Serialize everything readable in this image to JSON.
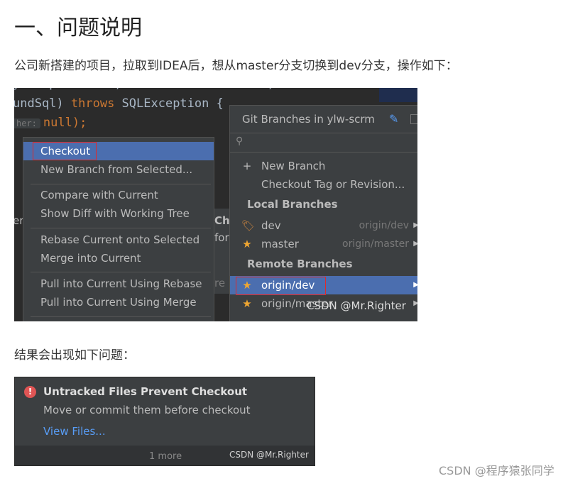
{
  "heading": "一、问题说明",
  "intro": "公司新搭建的项目，拉取到IDEA后，想从master分支切换到dev分支，操作如下：",
  "result_text": "结果会出现如下问题：",
  "page_watermark": "CSDN @程序猿张同学",
  "screenshot1": {
    "code_lines": [
      "undSql) throws SQLException {",
      "null);"
    ],
    "code_kw": "throws",
    "code_hint": "her:",
    "context_menu": [
      "Checkout",
      "New Branch from Selected...",
      "Compare with Current",
      "Show Diff with Working Tree",
      "Rebase Current onto Selected",
      "Merge into Current",
      "Pull into Current Using Rebase",
      "Pull into Current Using Merge"
    ],
    "middle_fragments": [
      "Ch",
      "for",
      "re"
    ],
    "left_fragment": "er",
    "git_popup": {
      "title": "Git Branches in ylw-scrm",
      "search_icon": "search-icon",
      "actions": [
        "New Branch",
        "Checkout Tag or Revision..."
      ],
      "local_header": "Local Branches",
      "local": [
        {
          "name": "dev",
          "tracking": "origin/dev",
          "icon": "tag-icon"
        },
        {
          "name": "master",
          "tracking": "origin/master",
          "icon": "star-icon"
        }
      ],
      "remote_header": "Remote Branches",
      "remote": [
        {
          "name": "origin/dev",
          "icon": "star-icon"
        },
        {
          "name": "origin/master",
          "icon": "star-icon"
        }
      ]
    },
    "watermark": "CSDN @Mr.Righter"
  },
  "screenshot2": {
    "title": "Untracked Files Prevent Checkout",
    "message": "Move or commit them before checkout",
    "link": "View Files...",
    "more": "1 more",
    "watermark": "CSDN @Mr.Righter"
  },
  "colors": {
    "ide_background": "#2b2b2b",
    "popup_background": "#3c3f41",
    "selection": "#4b6eaf",
    "highlight_box": "#e02a2a",
    "link": "#589df6"
  }
}
